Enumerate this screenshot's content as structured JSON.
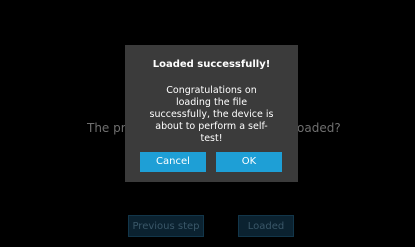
{
  "background": {
    "question": "The print file has been loaded, is it to be loaded?",
    "question_left_visible": "The pri",
    "question_right_visible": "oaded?",
    "prev_button_label": "Previous step",
    "loaded_button_label": "Loaded"
  },
  "dialog": {
    "title": "Loaded successfully!",
    "message_lines": [
      "Congratulations on",
      "loading the file",
      "successfully, the device is",
      "about to perform a self-",
      "test!"
    ],
    "cancel_label": "Cancel",
    "ok_label": "OK"
  },
  "colors": {
    "background": "#000000",
    "dialog_bg": "#3b3b3b",
    "accent": "#1e9fd6"
  }
}
